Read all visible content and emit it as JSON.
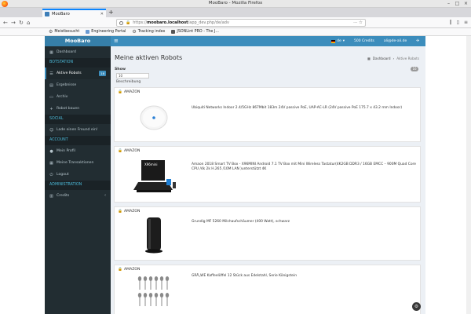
{
  "window": {
    "title": "MooBaro - Mozilla Firefox",
    "controls": [
      "–",
      "□",
      "×"
    ]
  },
  "browser": {
    "tab_label": "MooBaro",
    "url_host": "moobaro.localhost",
    "url_path": "/app_dev.php/de/adv",
    "url_scheme": "https://",
    "new_tab": "+",
    "bookmarks": [
      "Meistbesucht",
      "Engineering Portal",
      "Tracking index",
      "JSONLint PRO - The J..."
    ]
  },
  "header": {
    "logo": "MooBaro",
    "menu_icon": "≡",
    "language": "de",
    "credits": "500 Credits",
    "user_email": "ali@de-ali.de"
  },
  "sidebar": {
    "dashboard": "Dashboard",
    "section_botstation": "BOTSTATION",
    "active_robots": "Aktive Robots",
    "active_robots_badge": "16",
    "results": "Ergebnisse",
    "archive": "Archiv",
    "build_robot": "Robot bauen",
    "section_social": "SOCIAL",
    "invite_friend": "Lade einen Freund ein!",
    "section_account": "ACCOUNT",
    "profile": "Mein Profil",
    "transactions": "Meine Transaktionen",
    "logout": "Logout",
    "section_admin": "ADMINISTRATION",
    "credits": "Credits"
  },
  "main": {
    "title": "Meine aktiven Robots",
    "breadcrumb_home": "Dashboard",
    "breadcrumb_current": "Aktive Robots",
    "show_label": "Show",
    "show_value": "10",
    "description_label": "Beschreibung",
    "count_badge": "16",
    "robots": [
      {
        "source": "AMAZON",
        "title": "Ubiquiti Networks Indoor 2.4/5GHz 867Mbit 183m 24V passive PoE, UAP-AC-LR (24V passive PoE 175.7 x 43.2 mm Indoor)"
      },
      {
        "source": "AMAZON",
        "title": "Amaon 2018 Smart TV Box - X96MINI Android 7.1 TV Box mit Mini Wireless Tastatur(4K2GB DDR3 / 16GB EMCC – 900M Quad Core CPU /4k 2k H.265 /10M LAN )unterstützt 4K"
      },
      {
        "source": "AMAZON",
        "title": "Grundig MF 5260 Milchaufschäumer (400 Watt), schwarz"
      },
      {
        "source": "AMAZON",
        "title": "GRÄ„WE Kaffeelöffel 12 Stück aus Edelstahl, Serie Königstein"
      }
    ]
  },
  "box_brand": "X96mini"
}
